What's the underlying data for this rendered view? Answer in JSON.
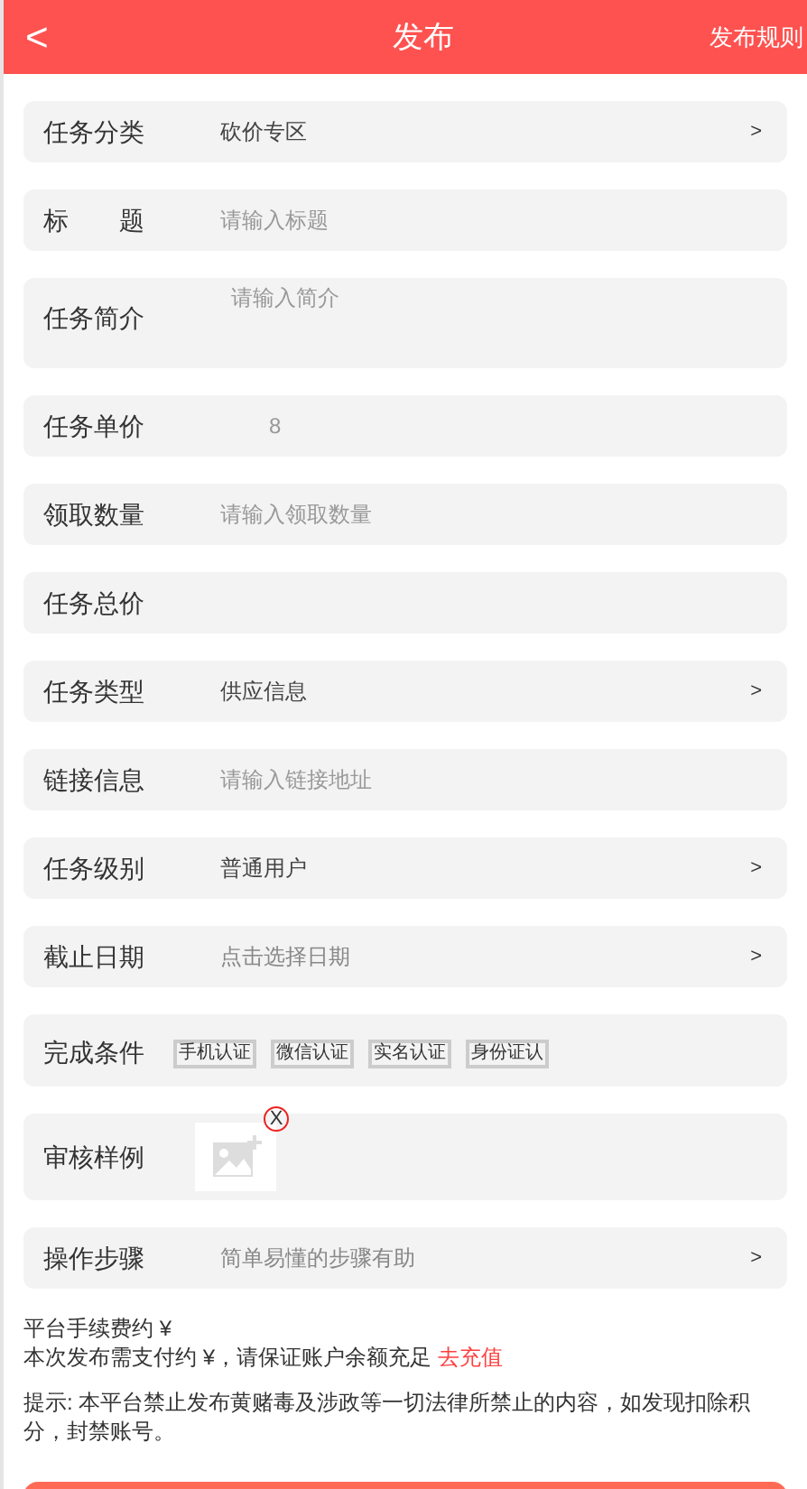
{
  "header": {
    "back": "<",
    "title": "发布",
    "rules": "发布规则"
  },
  "rows": [
    {
      "kind": "select",
      "label": "任务分类",
      "value": "砍价专区",
      "arrow": ">"
    },
    {
      "kind": "input",
      "label": "标　　题",
      "placeholder": "请输入标题"
    },
    {
      "kind": "textarea",
      "label": "任务简介",
      "placeholder": "请输入简介"
    },
    {
      "kind": "value",
      "label": "任务单价",
      "value": "8"
    },
    {
      "kind": "input",
      "label": "领取数量",
      "placeholder": "请输入领取数量"
    },
    {
      "kind": "value",
      "label": "任务总价"
    },
    {
      "kind": "select",
      "label": "任务类型",
      "value": "供应信息",
      "arrow": ">"
    },
    {
      "kind": "input",
      "label": "链接信息",
      "placeholder": "请输入链接地址"
    },
    {
      "kind": "select",
      "label": "任务级别",
      "value": "普通用户",
      "arrow": ">"
    },
    {
      "kind": "select",
      "label": "截止日期",
      "placeholder": "点击选择日期",
      "arrow": ">"
    },
    {
      "kind": "tags",
      "label": "完成条件",
      "tags": [
        "手机认证",
        "微信认证",
        "实名认证",
        "身份证认"
      ]
    },
    {
      "kind": "image",
      "label": "审核样例",
      "remove": "X"
    },
    {
      "kind": "select",
      "label": "操作步骤",
      "placeholder": "简单易懂的步骤有助",
      "arrow": ">"
    }
  ],
  "fee_line": "平台手续费约 ¥",
  "pay_line": {
    "text": "本次发布需支付约 ¥，请保证账户余额充足",
    "link": "去充值"
  },
  "notice": "提示: 本平台禁止发布黄赌毒及涉政等一切法律所禁止的内容，如发现扣除积分，封禁账号。"
}
